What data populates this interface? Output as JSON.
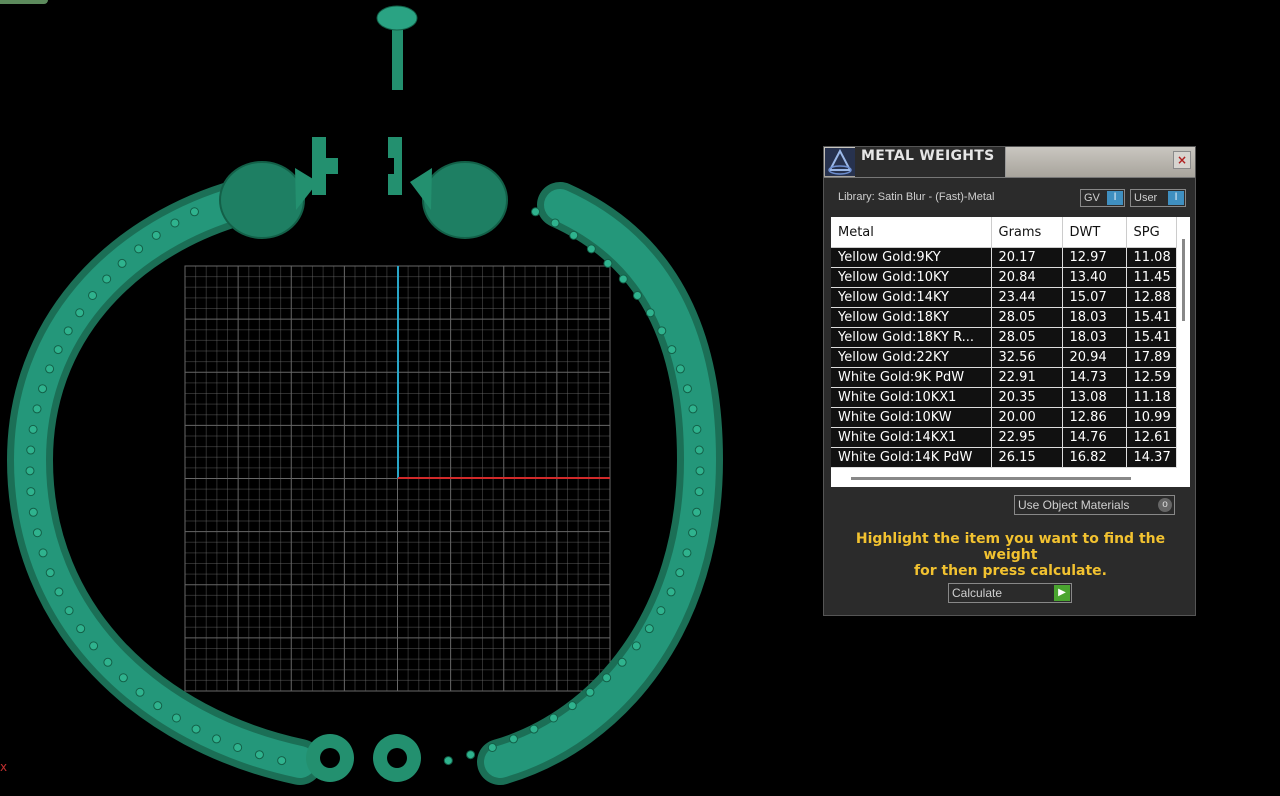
{
  "panel": {
    "title": "METAL WEIGHTS",
    "close_icon": "×",
    "library_label": "Library: Satin Blur - (Fast)-Metal",
    "gv_label": "GV",
    "user_label": "User",
    "table": {
      "headers": [
        "Metal",
        "Grams",
        "DWT",
        "SPG"
      ],
      "rows": [
        [
          "Yellow Gold:9KY",
          "20.17",
          "12.97",
          "11.08"
        ],
        [
          "Yellow Gold:10KY",
          "20.84",
          "13.40",
          "11.45"
        ],
        [
          "Yellow Gold:14KY",
          "23.44",
          "15.07",
          "12.88"
        ],
        [
          "Yellow Gold:18KY",
          "28.05",
          "18.03",
          "15.41"
        ],
        [
          "Yellow Gold:18KY R...",
          "28.05",
          "18.03",
          "15.41"
        ],
        [
          "Yellow Gold:22KY",
          "32.56",
          "20.94",
          "17.89"
        ],
        [
          "White Gold:9K PdW",
          "22.91",
          "14.73",
          "12.59"
        ],
        [
          "White Gold:10KX1",
          "20.35",
          "13.08",
          "11.18"
        ],
        [
          "White Gold:10KW",
          "20.00",
          "12.86",
          "10.99"
        ],
        [
          "White Gold:14KX1",
          "22.95",
          "14.76",
          "12.61"
        ],
        [
          "White Gold:14K PdW",
          "26.15",
          "16.82",
          "14.37"
        ]
      ]
    },
    "materials_button": "Use Object Materials",
    "help_text_line1": "Highlight the item you want to find the weight",
    "help_text_line2": "for then press calculate.",
    "calculate_button": "Calculate"
  },
  "viewport": {
    "axis_marker": "x"
  },
  "colors": {
    "model": "#1f8a6b",
    "grid": "#8a8a8a",
    "y_axis": "#29a7c9",
    "x_axis": "#d22a2a",
    "help_text": "#f2c230"
  }
}
